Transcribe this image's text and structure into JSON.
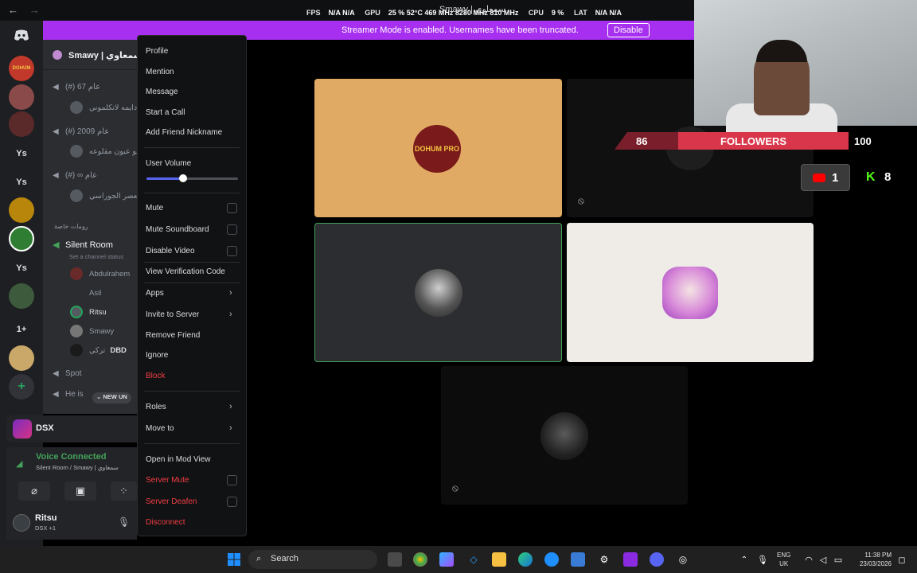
{
  "topbar": {
    "back": "←",
    "forward": "→",
    "stats": [
      {
        "label": "FPS",
        "value": "N/A  N/A"
      },
      {
        "label": "GPU",
        "value": "25 %  52°C  469 MHz  8280 MHz  810 MHz"
      },
      {
        "label": "CPU",
        "value": "9 %"
      },
      {
        "label": "LAT",
        "value": "N/A  N/A"
      }
    ],
    "app_title": "Smawy | سمعاوي"
  },
  "banner": {
    "text": "Streamer Mode is enabled. Usernames have been truncated.",
    "button": "Disable",
    "color": "#a72ff0"
  },
  "rail": {
    "servers": [
      {
        "label": "",
        "name": "discord-home-icon"
      },
      {
        "label": "",
        "name": "server-dohum-icon"
      },
      {
        "label": "",
        "name": "server-2-icon"
      },
      {
        "label": "",
        "name": "server-3-icon"
      },
      {
        "label": "Ys",
        "name": "server-ys-1"
      },
      {
        "label": "Ys",
        "name": "server-ys-2"
      },
      {
        "label": "",
        "name": "server-4-icon"
      },
      {
        "label": "",
        "name": "server-5-icon"
      },
      {
        "label": "Ys",
        "name": "server-ys-3"
      },
      {
        "label": "",
        "name": "server-6-icon"
      },
      {
        "label": "1+",
        "name": "server-1plus"
      },
      {
        "label": "",
        "name": "server-7-icon"
      },
      {
        "label": "+",
        "name": "add-server-button"
      }
    ]
  },
  "sidebar": {
    "guild_name": "Smawy | سمعاوي",
    "channels": [
      {
        "label": "(#) 67 عام",
        "members": [
          "دايمه لاتكلموني"
        ]
      },
      {
        "label": "(#) 2009 عام",
        "members": [
          "ابو عيون مقلوعه"
        ]
      },
      {
        "label": "(#) ∞ عام",
        "members": [
          "العصر الجوراسي"
        ]
      }
    ],
    "category": "رومات خاصة",
    "active_channel": "Silent Room",
    "active_status": "Set a channel status",
    "active_members": [
      "Abdulrahem",
      "Asil",
      "Ritsu",
      "Smawy",
      "تركي"
    ],
    "dbd_tag": "DBD",
    "more_channels": [
      "Spot",
      "He is"
    ],
    "new_unreads": "NEW UN"
  },
  "dsx": {
    "label": "DSX"
  },
  "voice": {
    "status": "Voice Connected",
    "location": "Silent Room / Smawy | سمعاوي"
  },
  "user": {
    "name": "Ritsu",
    "sub": "DSX +1"
  },
  "menu": {
    "profile": "Profile",
    "mention": "Mention",
    "message": "Message",
    "start_call": "Start a Call",
    "add_nickname": "Add Friend Nickname",
    "user_volume": "User Volume",
    "volume_percent": 40,
    "mute": "Mute",
    "mute_soundboard": "Mute Soundboard",
    "disable_video": "Disable Video",
    "view_verification": "View Verification Code",
    "apps": "Apps",
    "invite": "Invite to Server",
    "remove_friend": "Remove Friend",
    "ignore": "Ignore",
    "block": "Block",
    "roles": "Roles",
    "move_to": "Move to",
    "mod_view": "Open in Mod View",
    "server_mute": "Server Mute",
    "server_deafen": "Server Deafen",
    "disconnect": "Disconnect"
  },
  "tiles": {
    "dohum_text": "DOHUM PRO",
    "accent_green": "#43a25a"
  },
  "overlay": {
    "followers_current": "86",
    "followers_label": "FOLLOWERS",
    "followers_goal": "100",
    "youtube_count": "1",
    "kick_label": "K",
    "kick_count": "8"
  },
  "taskbar": {
    "search": "Search",
    "lang": "ENG",
    "region": "UK",
    "time": "11:38 PM",
    "date": "23/03/2026"
  }
}
